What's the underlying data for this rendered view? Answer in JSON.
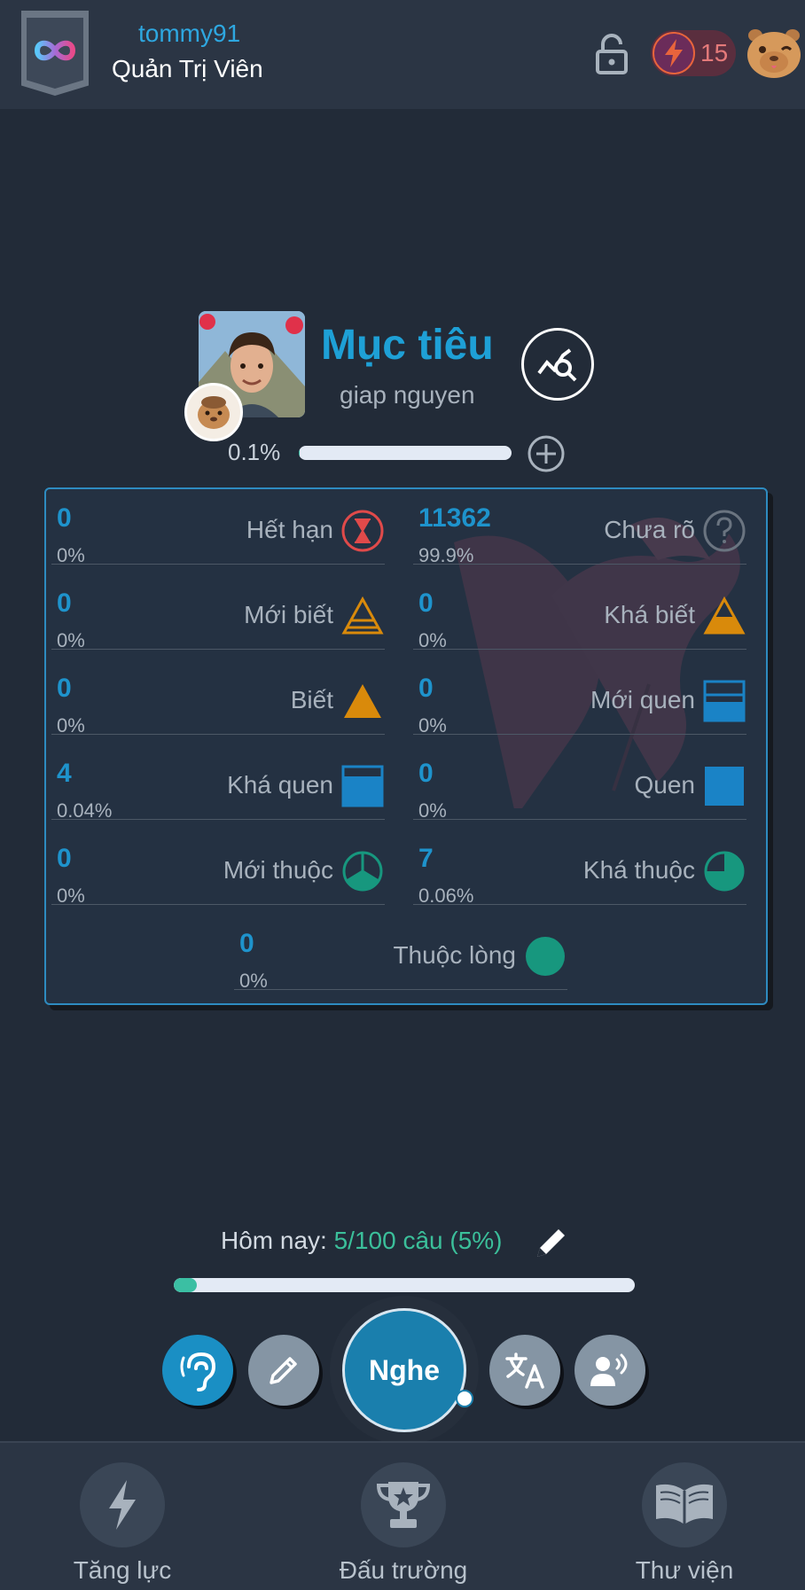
{
  "header": {
    "username": "tommy91",
    "role": "Quản Trị Viên",
    "energy_count": "15"
  },
  "goal": {
    "title": "Mục tiêu",
    "name": "giap nguyen",
    "progress_label": "0.1%",
    "progress_fraction": 0.001
  },
  "stats": [
    {
      "num": "0",
      "pct": "0%",
      "label": "Hết hạn",
      "icon": "hourglass-icon"
    },
    {
      "num": "11362",
      "pct": "99.9%",
      "label": "Chưa rõ",
      "icon": "question-icon"
    },
    {
      "num": "0",
      "pct": "0%",
      "label": "Mới biết",
      "icon": "triangle-outline-icon"
    },
    {
      "num": "0",
      "pct": "0%",
      "label": "Khá biết",
      "icon": "triangle-half-icon"
    },
    {
      "num": "0",
      "pct": "0%",
      "label": "Biết",
      "icon": "triangle-full-icon"
    },
    {
      "num": "0",
      "pct": "0%",
      "label": "Mới quen",
      "icon": "square-outline-icon"
    },
    {
      "num": "4",
      "pct": "0.04%",
      "label": "Khá quen",
      "icon": "square-half-icon"
    },
    {
      "num": "0",
      "pct": "0%",
      "label": "Quen",
      "icon": "square-full-icon"
    },
    {
      "num": "0",
      "pct": "0%",
      "label": "Mới thuộc",
      "icon": "circle-outline-icon"
    },
    {
      "num": "7",
      "pct": "0.06%",
      "label": "Khá thuộc",
      "icon": "circle-half-icon"
    },
    {
      "num": "0",
      "pct": "0%",
      "label": "Thuộc lòng",
      "icon": "circle-full-icon"
    }
  ],
  "today": {
    "prefix": "Hôm nay:",
    "value": "5/100 câu (5%)",
    "progress_fraction": 0.05
  },
  "actions": {
    "main_label": "Nghe"
  },
  "nav": [
    {
      "label": "Tăng lực",
      "icon": "bolt-icon"
    },
    {
      "label": "Đấu trường",
      "icon": "trophy-icon"
    },
    {
      "label": "Thư viện",
      "icon": "book-icon"
    }
  ],
  "colors": {
    "accent_blue": "#1ea0d6",
    "teal": "#17977e",
    "orange": "#d98a0b",
    "red": "#e04a4a"
  }
}
